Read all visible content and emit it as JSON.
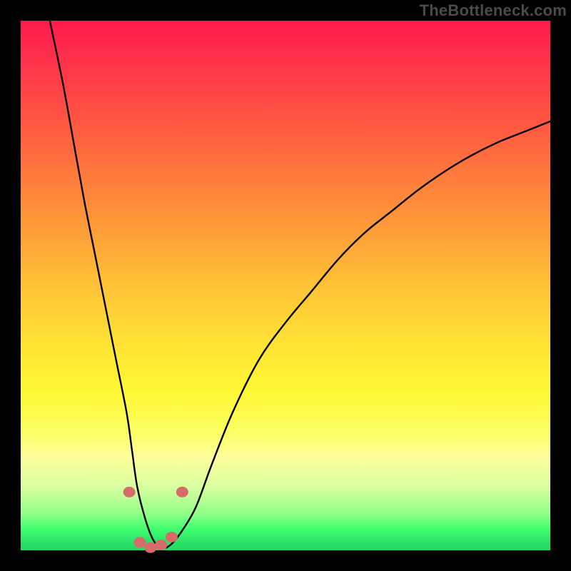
{
  "watermark": "TheBottleneck.com",
  "colors": {
    "background": "#000000",
    "curve_stroke": "#000000",
    "marker_fill": "#d96a6a",
    "marker_stroke": "#bb4b4b"
  },
  "chart_data": {
    "type": "line",
    "title": "",
    "xlabel": "",
    "ylabel": "",
    "xlim": [
      0,
      100
    ],
    "ylim": [
      0,
      100
    ],
    "series": [
      {
        "name": "bottleneck-curve",
        "x": [
          5.5,
          8,
          10,
          12,
          14,
          16,
          18,
          20,
          21,
          22,
          23.5,
          25,
          26.5,
          28,
          30,
          33,
          36,
          40,
          45,
          50,
          55,
          60,
          65,
          70,
          75,
          80,
          85,
          90,
          95,
          100
        ],
        "y": [
          100,
          88,
          77,
          66,
          56,
          46,
          36,
          26,
          19,
          12,
          6,
          2,
          0.5,
          0.8,
          3,
          8,
          16,
          26,
          36,
          43,
          49,
          55,
          60,
          64,
          68,
          71.5,
          74.5,
          77,
          79,
          81
        ]
      }
    ],
    "markers": [
      {
        "x": 20.5,
        "y": 11
      },
      {
        "x": 22.5,
        "y": 1.5
      },
      {
        "x": 24.5,
        "y": 0.5
      },
      {
        "x": 26.5,
        "y": 1
      },
      {
        "x": 28.5,
        "y": 2.5
      },
      {
        "x": 30.5,
        "y": 11
      }
    ],
    "gradient_note": "vertical gradient from red (top, high bottleneck) through orange/yellow to green (bottom, low bottleneck)"
  }
}
